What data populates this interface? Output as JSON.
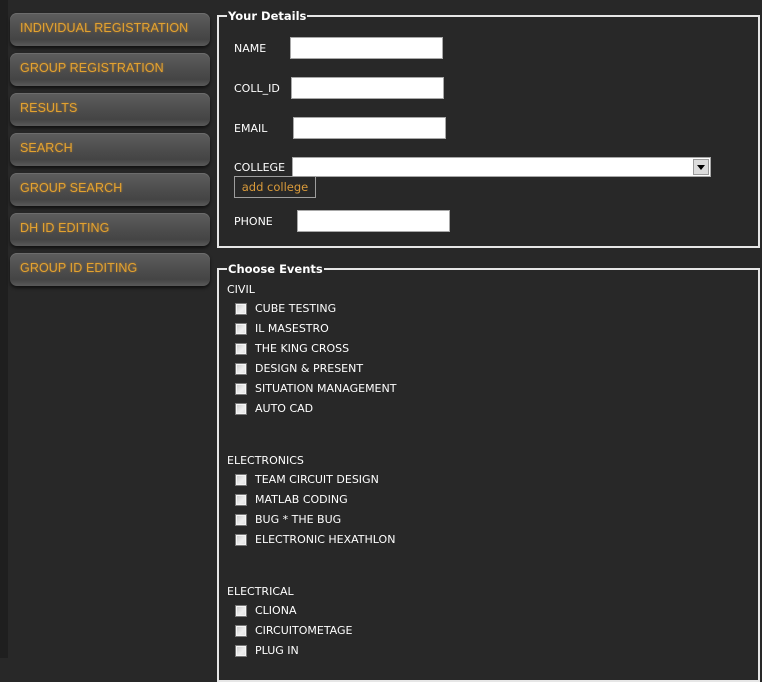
{
  "sidebar": {
    "items": [
      {
        "label": "INDIVIDUAL REGISTRATION"
      },
      {
        "label": "GROUP REGISTRATION"
      },
      {
        "label": "RESULTS"
      },
      {
        "label": "SEARCH"
      },
      {
        "label": "GROUP SEARCH"
      },
      {
        "label": "DH ID EDITING"
      },
      {
        "label": "GROUP ID EDITING"
      }
    ]
  },
  "details": {
    "legend": "Your Details",
    "name_label": "NAME",
    "name_value": "",
    "coll_id_label": "COLL_ID",
    "coll_id_value": "",
    "email_label": "EMAIL",
    "email_value": "",
    "college_label": "COLLEGE",
    "college_selected": "",
    "add_college_label": "add college",
    "phone_label": "PHONE",
    "phone_value": ""
  },
  "events": {
    "legend": "Choose Events",
    "categories": [
      {
        "name": "CIVIL",
        "items": [
          "CUBE TESTING",
          "IL MASESTRO",
          "THE KING CROSS",
          "DESIGN & PRESENT",
          "SITUATION MANAGEMENT",
          "AUTO CAD"
        ]
      },
      {
        "name": "ELECTRONICS",
        "items": [
          "TEAM CIRCUIT DESIGN",
          "MATLAB CODING",
          "BUG * THE BUG",
          "ELECTRONIC HEXATHLON"
        ]
      },
      {
        "name": "ELECTRICAL",
        "items": [
          "CLIONA",
          "CIRCUITOMETAGE",
          "PLUG IN"
        ]
      }
    ]
  },
  "colors": {
    "background": "#282828",
    "accent_text": "#e3a230",
    "fieldset_border": "#e6e6e6"
  }
}
